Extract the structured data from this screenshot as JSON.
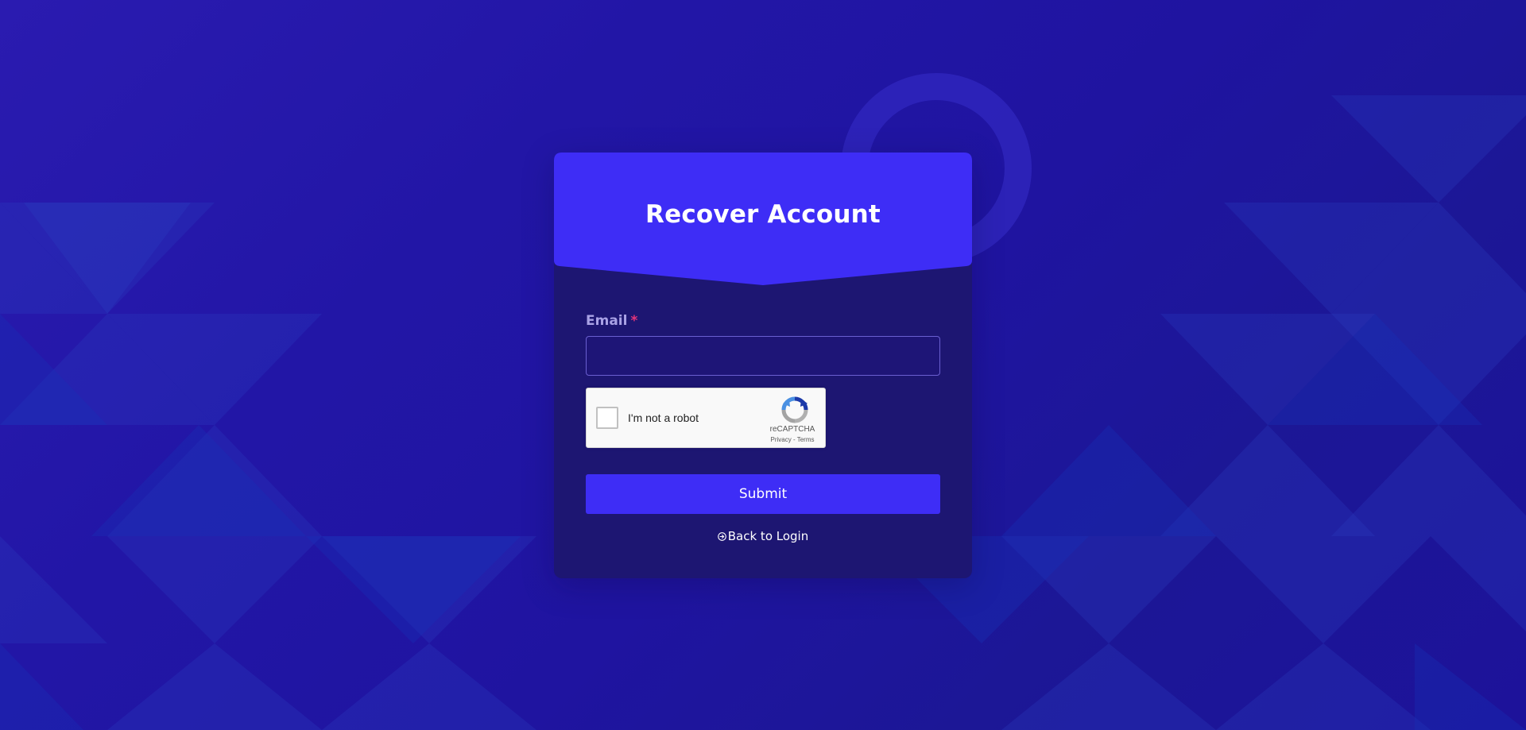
{
  "page": {
    "title": "Recover Account"
  },
  "form": {
    "email_label": "Email",
    "required_mark": "*",
    "email_value": "",
    "email_placeholder": "",
    "submit_label": "Submit",
    "back_label": "Back to Login"
  },
  "recaptcha": {
    "checkbox_label": "I'm not a robot",
    "brand": "reCAPTCHA",
    "privacy": "Privacy",
    "separator": " - ",
    "terms": "Terms"
  },
  "icons": {
    "back": "arrow-circle-right-icon",
    "recaptcha": "recaptcha-logo-icon"
  },
  "colors": {
    "background": "#2216a6",
    "card": "#1d1672",
    "header": "#3e2df6",
    "submit": "#3e2df6",
    "label": "#a9a2e6",
    "required": "#e5357a"
  }
}
